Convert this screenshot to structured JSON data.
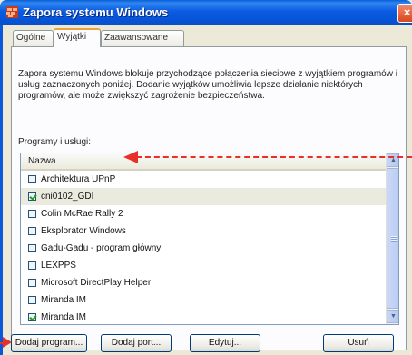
{
  "window": {
    "title": "Zapora systemu Windows",
    "close_label": "×"
  },
  "tabs": [
    {
      "label": "Ogólne",
      "active": false
    },
    {
      "label": "Wyjątki",
      "active": true
    },
    {
      "label": "Zaawansowane",
      "active": false
    }
  ],
  "description": "Zapora systemu Windows blokuje przychodzące połączenia sieciowe z wyjątkiem programów i usług zaznaczonych poniżej. Dodanie wyjątków umożliwia lepsze działanie niektórych programów, ale może zwiększyć zagrożenie bezpieczeństwa.",
  "programs_group_label": "Programy i usługi:",
  "list": {
    "column_header": "Nazwa",
    "items": [
      {
        "label": "Architektura UPnP",
        "checked": false,
        "selected": false
      },
      {
        "label": "cni0102_GDI",
        "checked": true,
        "selected": true
      },
      {
        "label": "Colin McRae Rally 2",
        "checked": false,
        "selected": false
      },
      {
        "label": "Eksplorator Windows",
        "checked": false,
        "selected": false
      },
      {
        "label": "Gadu-Gadu - program główny",
        "checked": false,
        "selected": false
      },
      {
        "label": "LEXPPS",
        "checked": false,
        "selected": false
      },
      {
        "label": "Microsoft DirectPlay Helper",
        "checked": false,
        "selected": false
      },
      {
        "label": "Miranda IM",
        "checked": false,
        "selected": false
      },
      {
        "label": "Miranda IM",
        "checked": true,
        "selected": false
      }
    ]
  },
  "buttons": {
    "add_program": "Dodaj program...",
    "add_port": "Dodaj port...",
    "edit": "Edytuj...",
    "delete": "Usuń"
  },
  "colors": {
    "titlebar": "#0a5fd8",
    "annotation_arrow": "#e8302a",
    "check": "#21a121"
  },
  "icons": {
    "window_icon": "firewall-shield-icon",
    "scroll_up": "scroll-up-arrow-icon",
    "scroll_down": "scroll-down-arrow-icon"
  }
}
